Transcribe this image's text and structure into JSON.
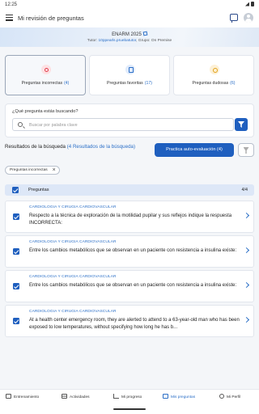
{
  "status_bar": {
    "time": "12:25"
  },
  "header": {
    "title": "Mi revisión de preguntas"
  },
  "banner": {
    "exam": "ENARM 2025",
    "tutor_label": "Tutor:",
    "tutor_name": "10ppearls.pruebatutor",
    "group_label": "Grupo:",
    "group_name": "On Premise"
  },
  "category_cards": [
    {
      "label": "Preguntas incorrectas",
      "count": "(4)",
      "icon": "incorrect-icon"
    },
    {
      "label": "Preguntas favoritas",
      "count": "(17)",
      "icon": "bookmark-icon"
    },
    {
      "label": "Preguntas dudosas",
      "count": "(6)",
      "icon": "doubt-icon"
    }
  ],
  "search": {
    "question": "¿Qué pregunta estás buscando?",
    "placeholder": "Buscar por palabra clave"
  },
  "results": {
    "title": "Resultados de la búsqueda",
    "count_text": "(4 Resultados de la búsqueda)",
    "practice_button": "Practica auto-evaluación (4)",
    "active_filter_chip": "Preguntas incorrectas"
  },
  "list": {
    "header_label": "Preguntas",
    "header_count": "4/4",
    "items": [
      {
        "category": "CARDIOLOGIA Y CIRUGIA CARDIOVASCULAR",
        "text": "Respecto a la técnica de exploración de la motilidad pupilar y sus reflejos indique la respuesta INCORRECTA:"
      },
      {
        "category": "CARDIOLOGIA Y CIRUGIA CARDIOVASCULAR",
        "text": "Entre los cambios metabólicos que se observan en un paciente con resistencia a insulina existe:"
      },
      {
        "category": "CARDIOLOGIA Y CIRUGIA CARDIOVASCULAR",
        "text": "Entre los cambios metabólicos que se observan en un paciente con resistencia a insulina existe:"
      },
      {
        "category": "CARDIOLOGIA Y CIRUGIA CARDIOVASCULAR",
        "text": "At a health center emergency room, they are alerted to attend to a 63-year-old man who has been exposed to low temperatures, without specifying how long he has b..."
      }
    ]
  },
  "bottom_nav": [
    {
      "label": "Entrenamiento",
      "icon": "training-icon"
    },
    {
      "label": "Actividades",
      "icon": "activities-icon"
    },
    {
      "label": "Mi progreso",
      "icon": "progress-icon"
    },
    {
      "label": "Mis preguntas",
      "icon": "my-questions-icon",
      "active": true
    },
    {
      "label": "Mi Perfil",
      "icon": "profile-icon"
    }
  ],
  "colors": {
    "primary": "#1f5fbf",
    "accent_text": "#2b6fc7",
    "header_row": "#dde7f7"
  }
}
